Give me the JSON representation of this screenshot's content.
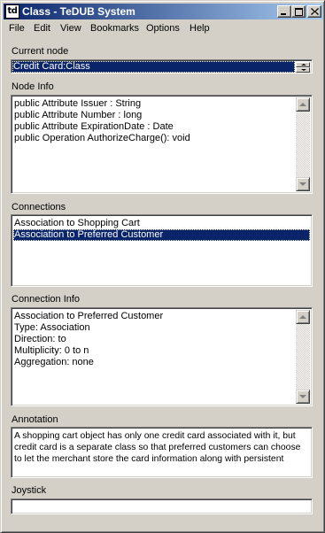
{
  "window": {
    "icon_text": "td",
    "title": "Class - TeDUB System"
  },
  "menu": [
    "File",
    "Edit",
    "View",
    "Bookmarks",
    "Options",
    "Help"
  ],
  "current_node": {
    "label": "Current node",
    "value": "Credit Card:Class"
  },
  "node_info": {
    "label": "Node Info",
    "lines": [
      "public Attribute Issuer : String",
      "public Attribute Number : long",
      "public Attribute ExpirationDate : Date",
      "public  Operation AuthorizeCharge(): void"
    ]
  },
  "connections": {
    "label": "Connections",
    "items": [
      "Association to Shopping Cart",
      "Association to Preferred Customer"
    ],
    "selected_index": 1
  },
  "connection_info": {
    "label": "Connection Info",
    "lines": [
      "Association to Preferred Customer",
      "Type: Association",
      "Direction: to",
      "Multiplicity: 0 to n",
      "Aggregation: none"
    ]
  },
  "annotation": {
    "label": "Annotation",
    "lines": [
      "A shopping cart object has only one credit card associated with it, but",
      "credit card is a separate class so that preferred customers can choose",
      "to let the merchant store the card information along with persistent"
    ]
  },
  "joystick": {
    "label": "Joystick",
    "value": ""
  },
  "colors": {
    "window_bg": "#d4d0c8",
    "title_gradient_start": "#0a246a",
    "title_gradient_end": "#a6caf0",
    "selection": "#0a246a"
  }
}
